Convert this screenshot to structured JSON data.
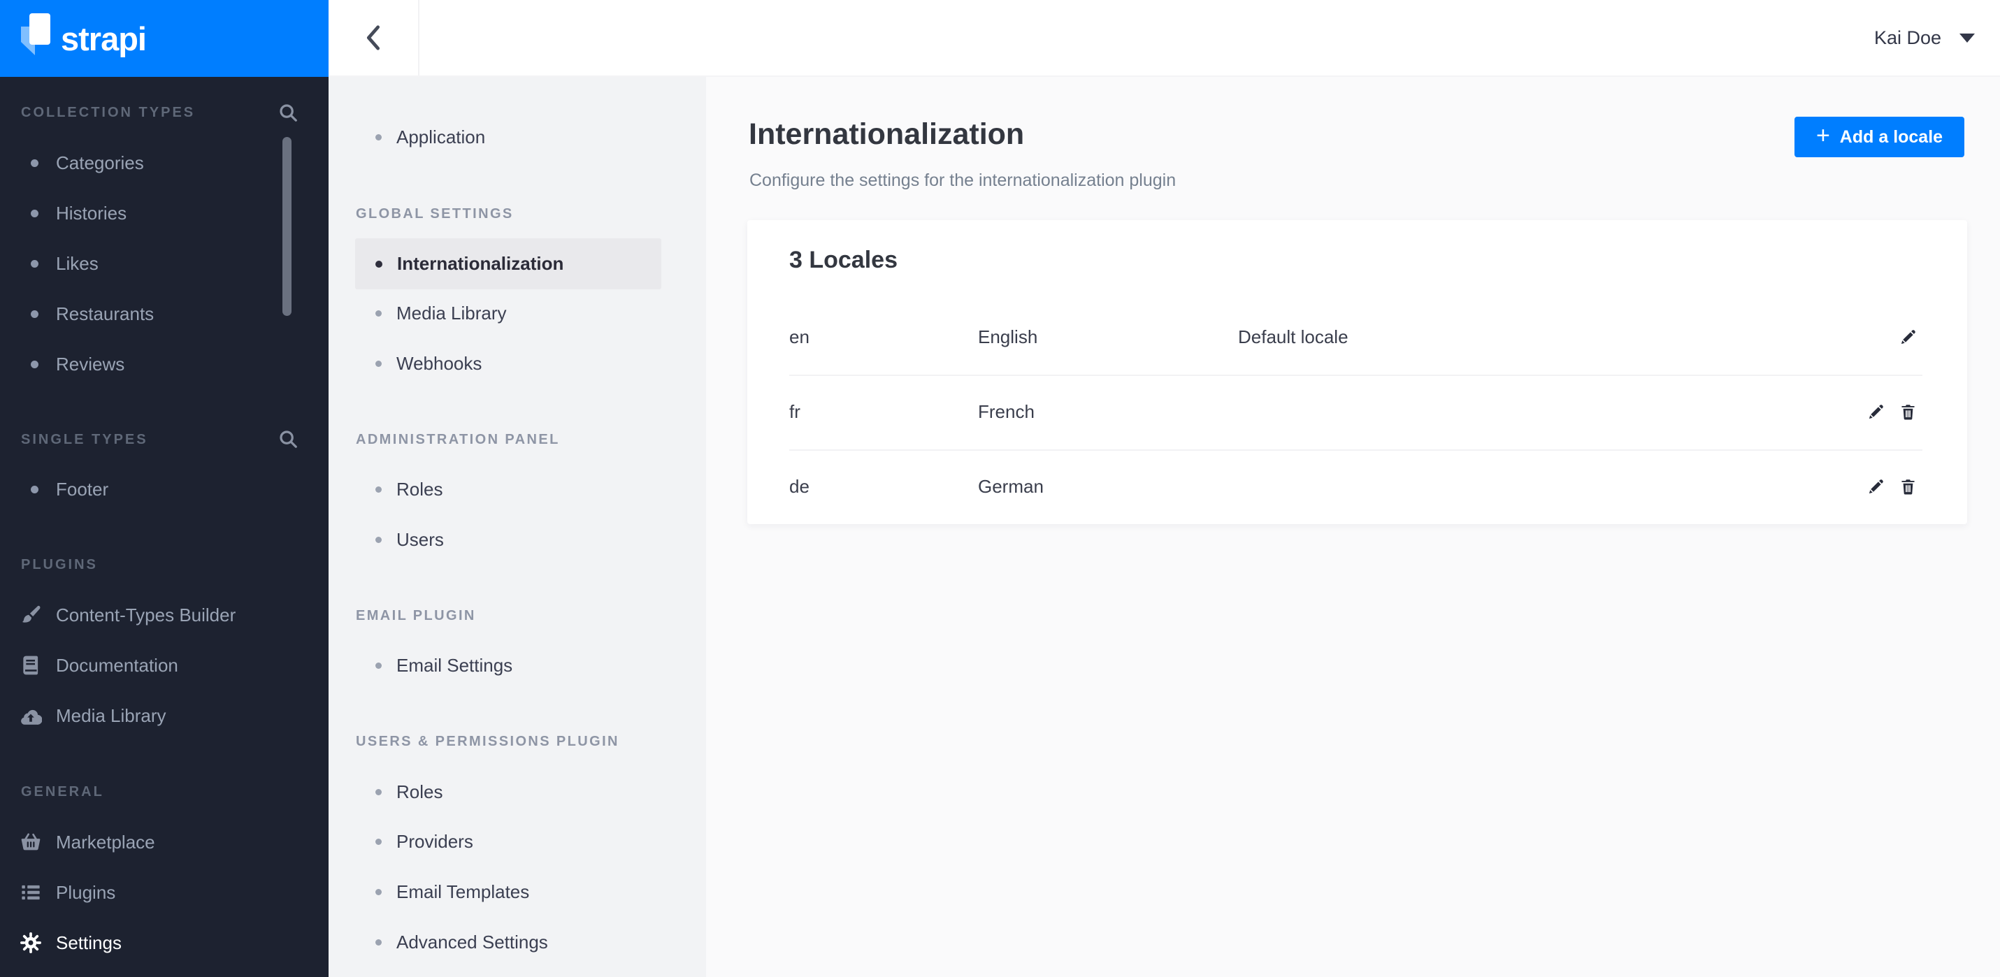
{
  "brand": {
    "logo_text": "strapi",
    "logo_icon": "strapi-flag-icon",
    "header_color": "#007eff"
  },
  "left_sidebar": {
    "bg_color": "#1d2230",
    "sections": [
      {
        "title": "COLLECTION TYPES",
        "search_icon": "magnifier",
        "items": [
          {
            "label": "Categories"
          },
          {
            "label": "Histories"
          },
          {
            "label": "Likes"
          },
          {
            "label": "Restaurants"
          },
          {
            "label": "Reviews"
          }
        ]
      },
      {
        "title": "SINGLE TYPES",
        "search_icon": "magnifier",
        "items": [
          {
            "label": "Footer"
          }
        ]
      },
      {
        "title": "PLUGINS",
        "items": [
          {
            "label": "Content-Types Builder",
            "icon": "paintbrush"
          },
          {
            "label": "Documentation",
            "icon": "book"
          },
          {
            "label": "Media Library",
            "icon": "cloud-upload"
          }
        ]
      },
      {
        "title": "GENERAL",
        "items": [
          {
            "label": "Marketplace",
            "icon": "shopping-basket"
          },
          {
            "label": "Plugins",
            "icon": "list"
          },
          {
            "label": "Settings",
            "icon": "gear",
            "active": true
          }
        ]
      }
    ]
  },
  "topbar": {
    "back_icon": "chevron-left",
    "user_name": "Kai Doe",
    "user_menu_icon": "caret-down"
  },
  "settings_sidebar": {
    "bg_color": "#f2f3f5",
    "standalone_items": [
      {
        "label": "Application"
      }
    ],
    "sections": [
      {
        "title": "GLOBAL SETTINGS",
        "items": [
          {
            "label": "Internationalization",
            "active": true
          },
          {
            "label": "Media Library"
          },
          {
            "label": "Webhooks"
          }
        ]
      },
      {
        "title": "ADMINISTRATION PANEL",
        "items": [
          {
            "label": "Roles"
          },
          {
            "label": "Users"
          }
        ]
      },
      {
        "title": "EMAIL PLUGIN",
        "items": [
          {
            "label": "Email Settings"
          }
        ]
      },
      {
        "title": "USERS & PERMISSIONS PLUGIN",
        "items": [
          {
            "label": "Roles"
          },
          {
            "label": "Providers"
          },
          {
            "label": "Email Templates"
          },
          {
            "label": "Advanced Settings"
          }
        ]
      }
    ]
  },
  "main": {
    "bg_color": "#fafafb",
    "title": "Internationalization",
    "subtitle": "Configure the settings for the internationalization plugin",
    "add_locale_button": {
      "label": "Add a locale",
      "icon": "plus",
      "color": "#007eff"
    },
    "card": {
      "title": "3 Locales",
      "rows": [
        {
          "code": "en",
          "name": "English",
          "info": "Default locale",
          "actions": [
            "edit"
          ]
        },
        {
          "code": "fr",
          "name": "French",
          "info": "",
          "actions": [
            "edit",
            "delete"
          ]
        },
        {
          "code": "de",
          "name": "German",
          "info": "",
          "actions": [
            "edit",
            "delete"
          ]
        }
      ]
    }
  }
}
